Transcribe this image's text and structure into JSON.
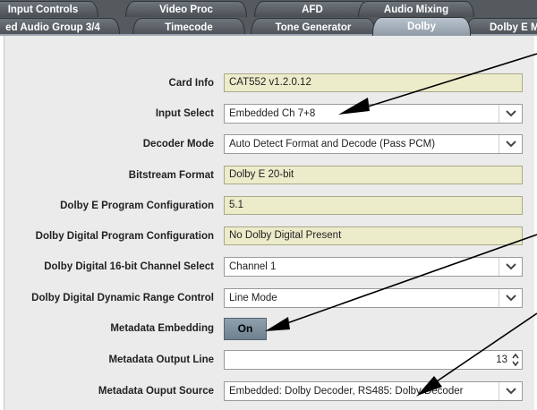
{
  "tabs": {
    "row1": [
      "Input Controls",
      "Video Proc",
      "AFD",
      "Audio Mixing"
    ],
    "row2": [
      "ed Audio Group 3/4",
      "Timecode",
      "Tone Generator",
      "Dolby",
      "Dolby E M"
    ],
    "active": "Dolby"
  },
  "form": {
    "card_info": {
      "label": "Card Info",
      "value": "CAT552 v1.2.0.12"
    },
    "input_select": {
      "label": "Input Select",
      "value": "Embedded Ch 7+8"
    },
    "decoder_mode": {
      "label": "Decoder Mode",
      "value": "Auto Detect Format and Decode (Pass PCM)"
    },
    "bitstream_format": {
      "label": "Bitstream Format",
      "value": "Dolby E 20-bit"
    },
    "dolby_e_program_config": {
      "label": "Dolby E Program Configuration",
      "value": "5.1"
    },
    "dolby_digital_program_config": {
      "label": "Dolby Digital Program Configuration",
      "value": "No Dolby Digital Present"
    },
    "dd_channel_select": {
      "label": "Dolby Digital 16-bit Channel Select",
      "value": "Channel 1"
    },
    "dd_drc": {
      "label": "Dolby Digital Dynamic Range Control",
      "value": "Line Mode"
    },
    "metadata_embedding": {
      "label": "Metadata Embedding",
      "value": "On"
    },
    "metadata_output_line": {
      "label": "Metadata Output Line",
      "value": "13"
    },
    "metadata_output_source": {
      "label": "Metadata Ouput Source",
      "value": "Embedded: Dolby Decoder, RS485: Dolby Decoder"
    }
  },
  "icons": {
    "dropdown": "chevron-down-icon",
    "spinner": "spinner-arrows-icon",
    "callout": "callout-arrow"
  },
  "colors": {
    "tab_bar": "#555a5f",
    "active_tab": "#9aa6b1",
    "panel": "#ebebeb",
    "readonly_field": "#ecebca",
    "toggle_on": "#7f90a0"
  }
}
